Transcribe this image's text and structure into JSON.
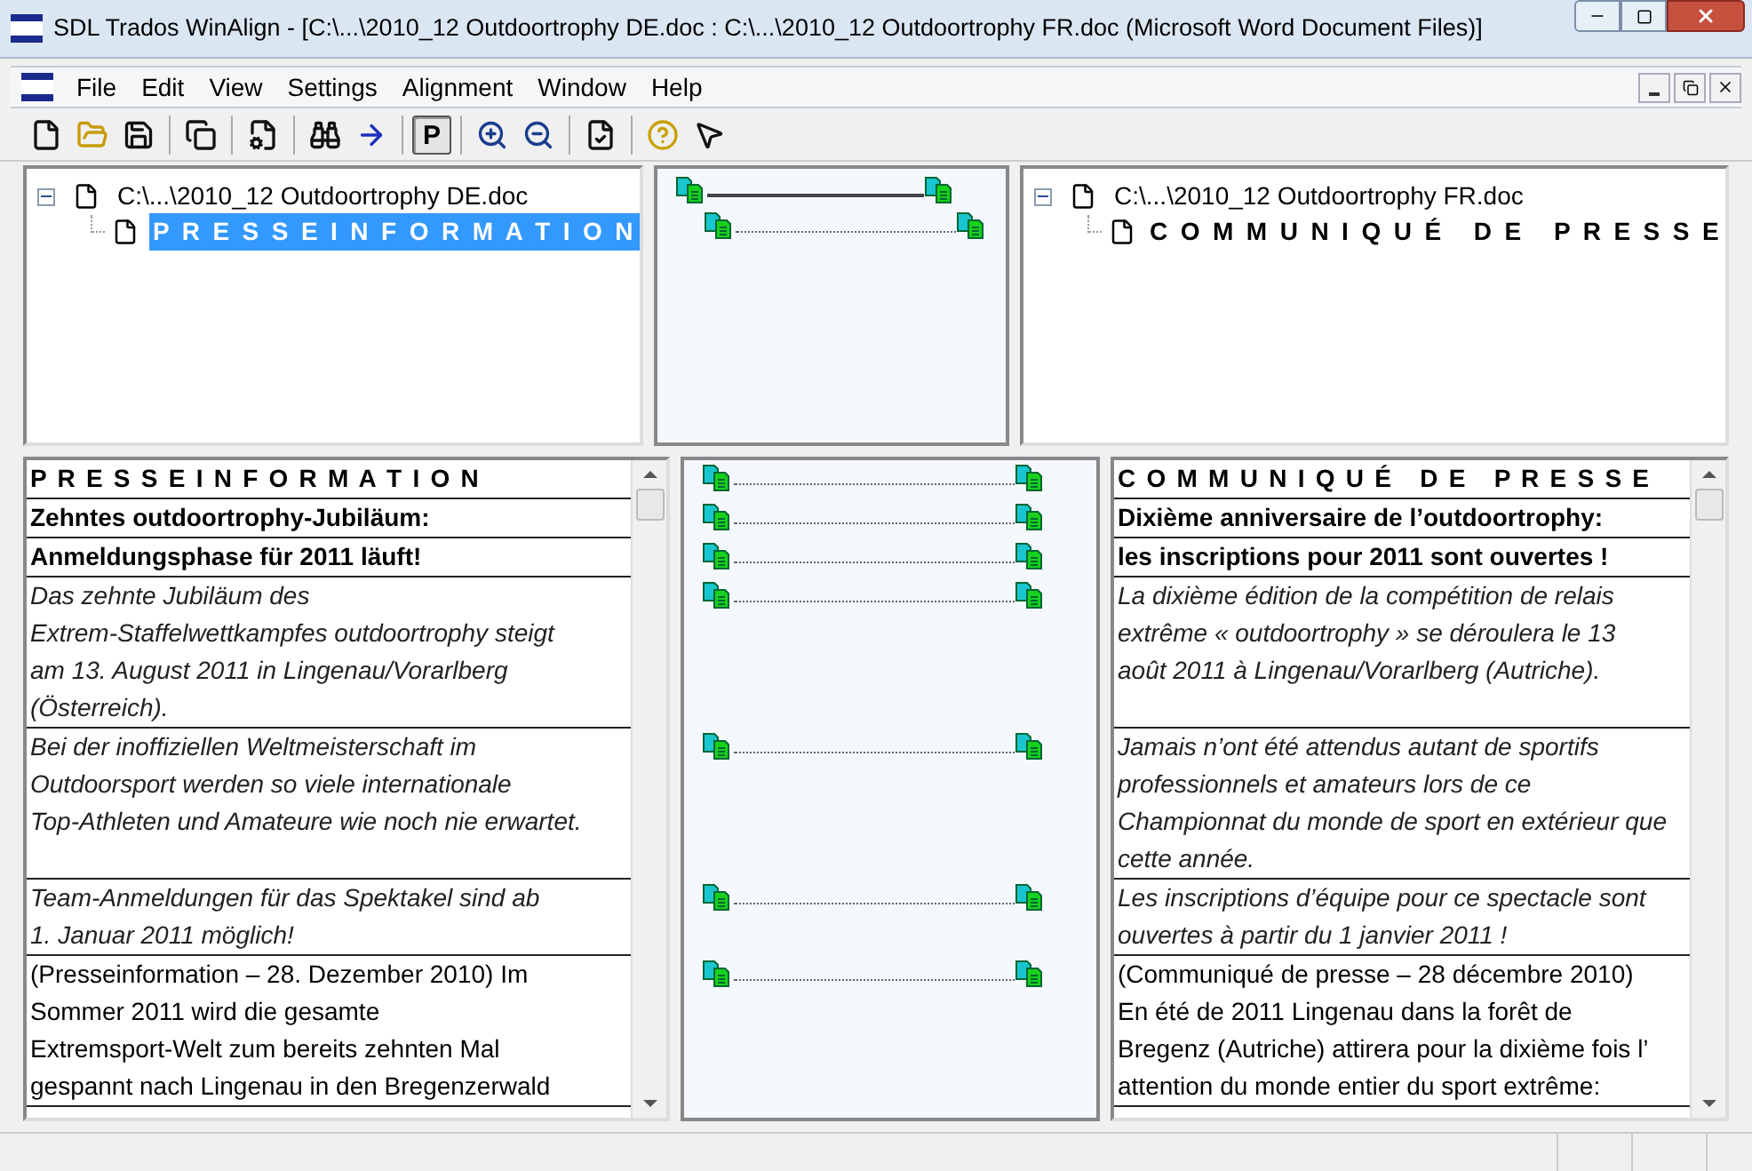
{
  "window": {
    "title": "SDL Trados WinAlign - [C:\\...\\2010_12 Outdoortrophy DE.doc : C:\\...\\2010_12 Outdoortrophy FR.doc (Microsoft Word Document Files)]"
  },
  "menu": [
    "File",
    "Edit",
    "View",
    "Settings",
    "Alignment",
    "Window",
    "Help"
  ],
  "toolbar": [
    {
      "kind": "toggle",
      "label": "P",
      "selected": true
    }
  ],
  "source_tree": {
    "file": "C:\\...\\2010_12 Outdoortrophy DE.doc",
    "expanded": true,
    "children": [
      {
        "label": "P R E S S E I N F O R M A T I O N",
        "selected": true
      }
    ]
  },
  "target_tree": {
    "file": "C:\\...\\2010_12 Outdoortrophy FR.doc",
    "expanded": true,
    "children": [
      {
        "label": "C O M M U N I Q U É   D E   P R E S S E",
        "selected": false
      }
    ]
  },
  "segments": [
    {
      "source": {
        "kind": "heading",
        "lines": [
          "P R E S S E I N F O R M A T I O N"
        ]
      },
      "target": {
        "kind": "heading",
        "lines": [
          "C O M M U N I Q U É   D E   P R E S S E"
        ]
      }
    },
    {
      "source": {
        "kind": "bold",
        "lines": [
          "Zehntes outdoortrophy-Jubiläum:"
        ]
      },
      "target": {
        "kind": "bold",
        "lines": [
          "Dixième anniversaire de l’outdoortrophy:"
        ]
      }
    },
    {
      "source": {
        "kind": "bold",
        "lines": [
          "Anmeldungsphase für 2011 läuft!"
        ]
      },
      "target": {
        "kind": "bold",
        "lines": [
          "les inscriptions pour 2011 sont ouvertes !"
        ]
      }
    },
    {
      "source": {
        "kind": "italic",
        "lines": [
          "Das zehnte Jubiläum des",
          "Extrem-Staffelwettkampfes outdoortrophy steigt",
          "am 13. August 2011 in Lingenau/Vorarlberg",
          "(Österreich)."
        ]
      },
      "target": {
        "kind": "italic",
        "lines": [
          "La dixième édition de la compétition de relais",
          "extrême « outdoortrophy » se déroulera le 13",
          "août 2011 à Lingenau/Vorarlberg (Autriche)."
        ]
      }
    },
    {
      "source": {
        "kind": "italic",
        "lines": [
          "Bei der inoffiziellen Weltmeisterschaft im",
          "Outdoorsport werden so viele internationale",
          "Top-Athleten und Amateure wie noch nie erwartet."
        ]
      },
      "target": {
        "kind": "italic",
        "lines": [
          "Jamais n’ont été attendus autant de sportifs",
          "professionnels et amateurs lors de ce",
          "Championnat du monde de sport en extérieur que",
          "cette année."
        ]
      }
    },
    {
      "source": {
        "kind": "italic",
        "lines": [
          "Team-Anmeldungen für das Spektakel sind ab",
          "1. Januar 2011 möglich!"
        ]
      },
      "target": {
        "kind": "italic",
        "lines": [
          "Les inscriptions d’équipe pour ce spectacle sont",
          "ouvertes à partir du 1 janvier 2011 !"
        ]
      }
    },
    {
      "source": {
        "kind": "normal",
        "lines": [
          "(Presseinformation – 28. Dezember 2010) Im",
          "Sommer 2011 wird die gesamte",
          "Extremsport-Welt zum bereits zehnten Mal",
          "gespannt nach Lingenau in den Bregenzerwald"
        ]
      },
      "target": {
        "kind": "normal",
        "lines": [
          "(Communiqué de presse – 28 décembre 2010)",
          "En été de 2011 Lingenau dans la forêt de",
          "Bregenz (Autriche) attirera pour la dixième fois l’",
          "attention du monde entier du sport extrême:"
        ]
      }
    }
  ]
}
